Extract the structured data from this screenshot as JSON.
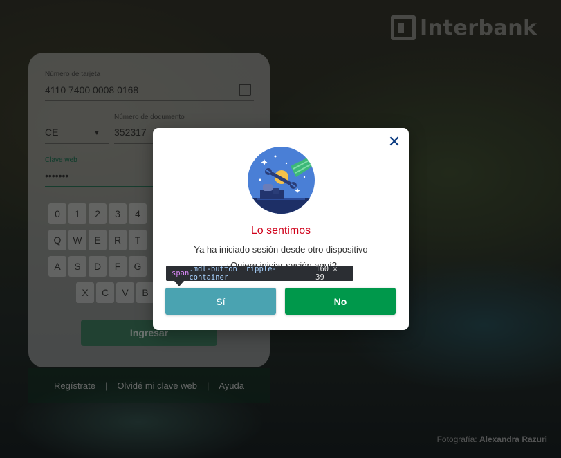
{
  "brand": {
    "name": "Interbank"
  },
  "login": {
    "card_number_label": "Número de tarjeta",
    "card_number_value": "4110 7400 0008 0168",
    "doc_type_value": "CE",
    "doc_number_label": "Número de documento",
    "doc_number_value": "352317",
    "password_label": "Clave web",
    "password_value": "•••••••",
    "keypad_rows": [
      [
        "0",
        "1",
        "2",
        "3",
        "4"
      ],
      [
        "Q",
        "W",
        "E",
        "R",
        "T"
      ],
      [
        "A",
        "S",
        "D",
        "F",
        "G"
      ],
      [
        "X",
        "C",
        "V",
        "B"
      ]
    ],
    "submit_label": "Ingresar"
  },
  "footer": {
    "register": "Regístrate",
    "separator": "|",
    "forgot": "Olvidé mi clave web",
    "help": "Ayuda"
  },
  "photo_credit": {
    "prefix": "Fotografía:",
    "author": "Alexandra Razuri"
  },
  "modal": {
    "title": "Lo sentimos",
    "message": "Ya ha iniciado sesión desde otro dispositivo",
    "question": "¿Quiere iniciar sesión aquí?",
    "yes_label": "Sí",
    "no_label": "No",
    "close_icon": "close-icon",
    "illustration_icon": "wrench-repair-illustration"
  },
  "devtools_tooltip": {
    "tag": "span",
    "class_name": ".mdl-button__ripple-container",
    "size": "160 × 39"
  },
  "colors": {
    "error_title": "#d0021b",
    "primary_green": "#00984b",
    "yes_teal": "#4aa3b1",
    "close_blue": "#0a3a80"
  }
}
